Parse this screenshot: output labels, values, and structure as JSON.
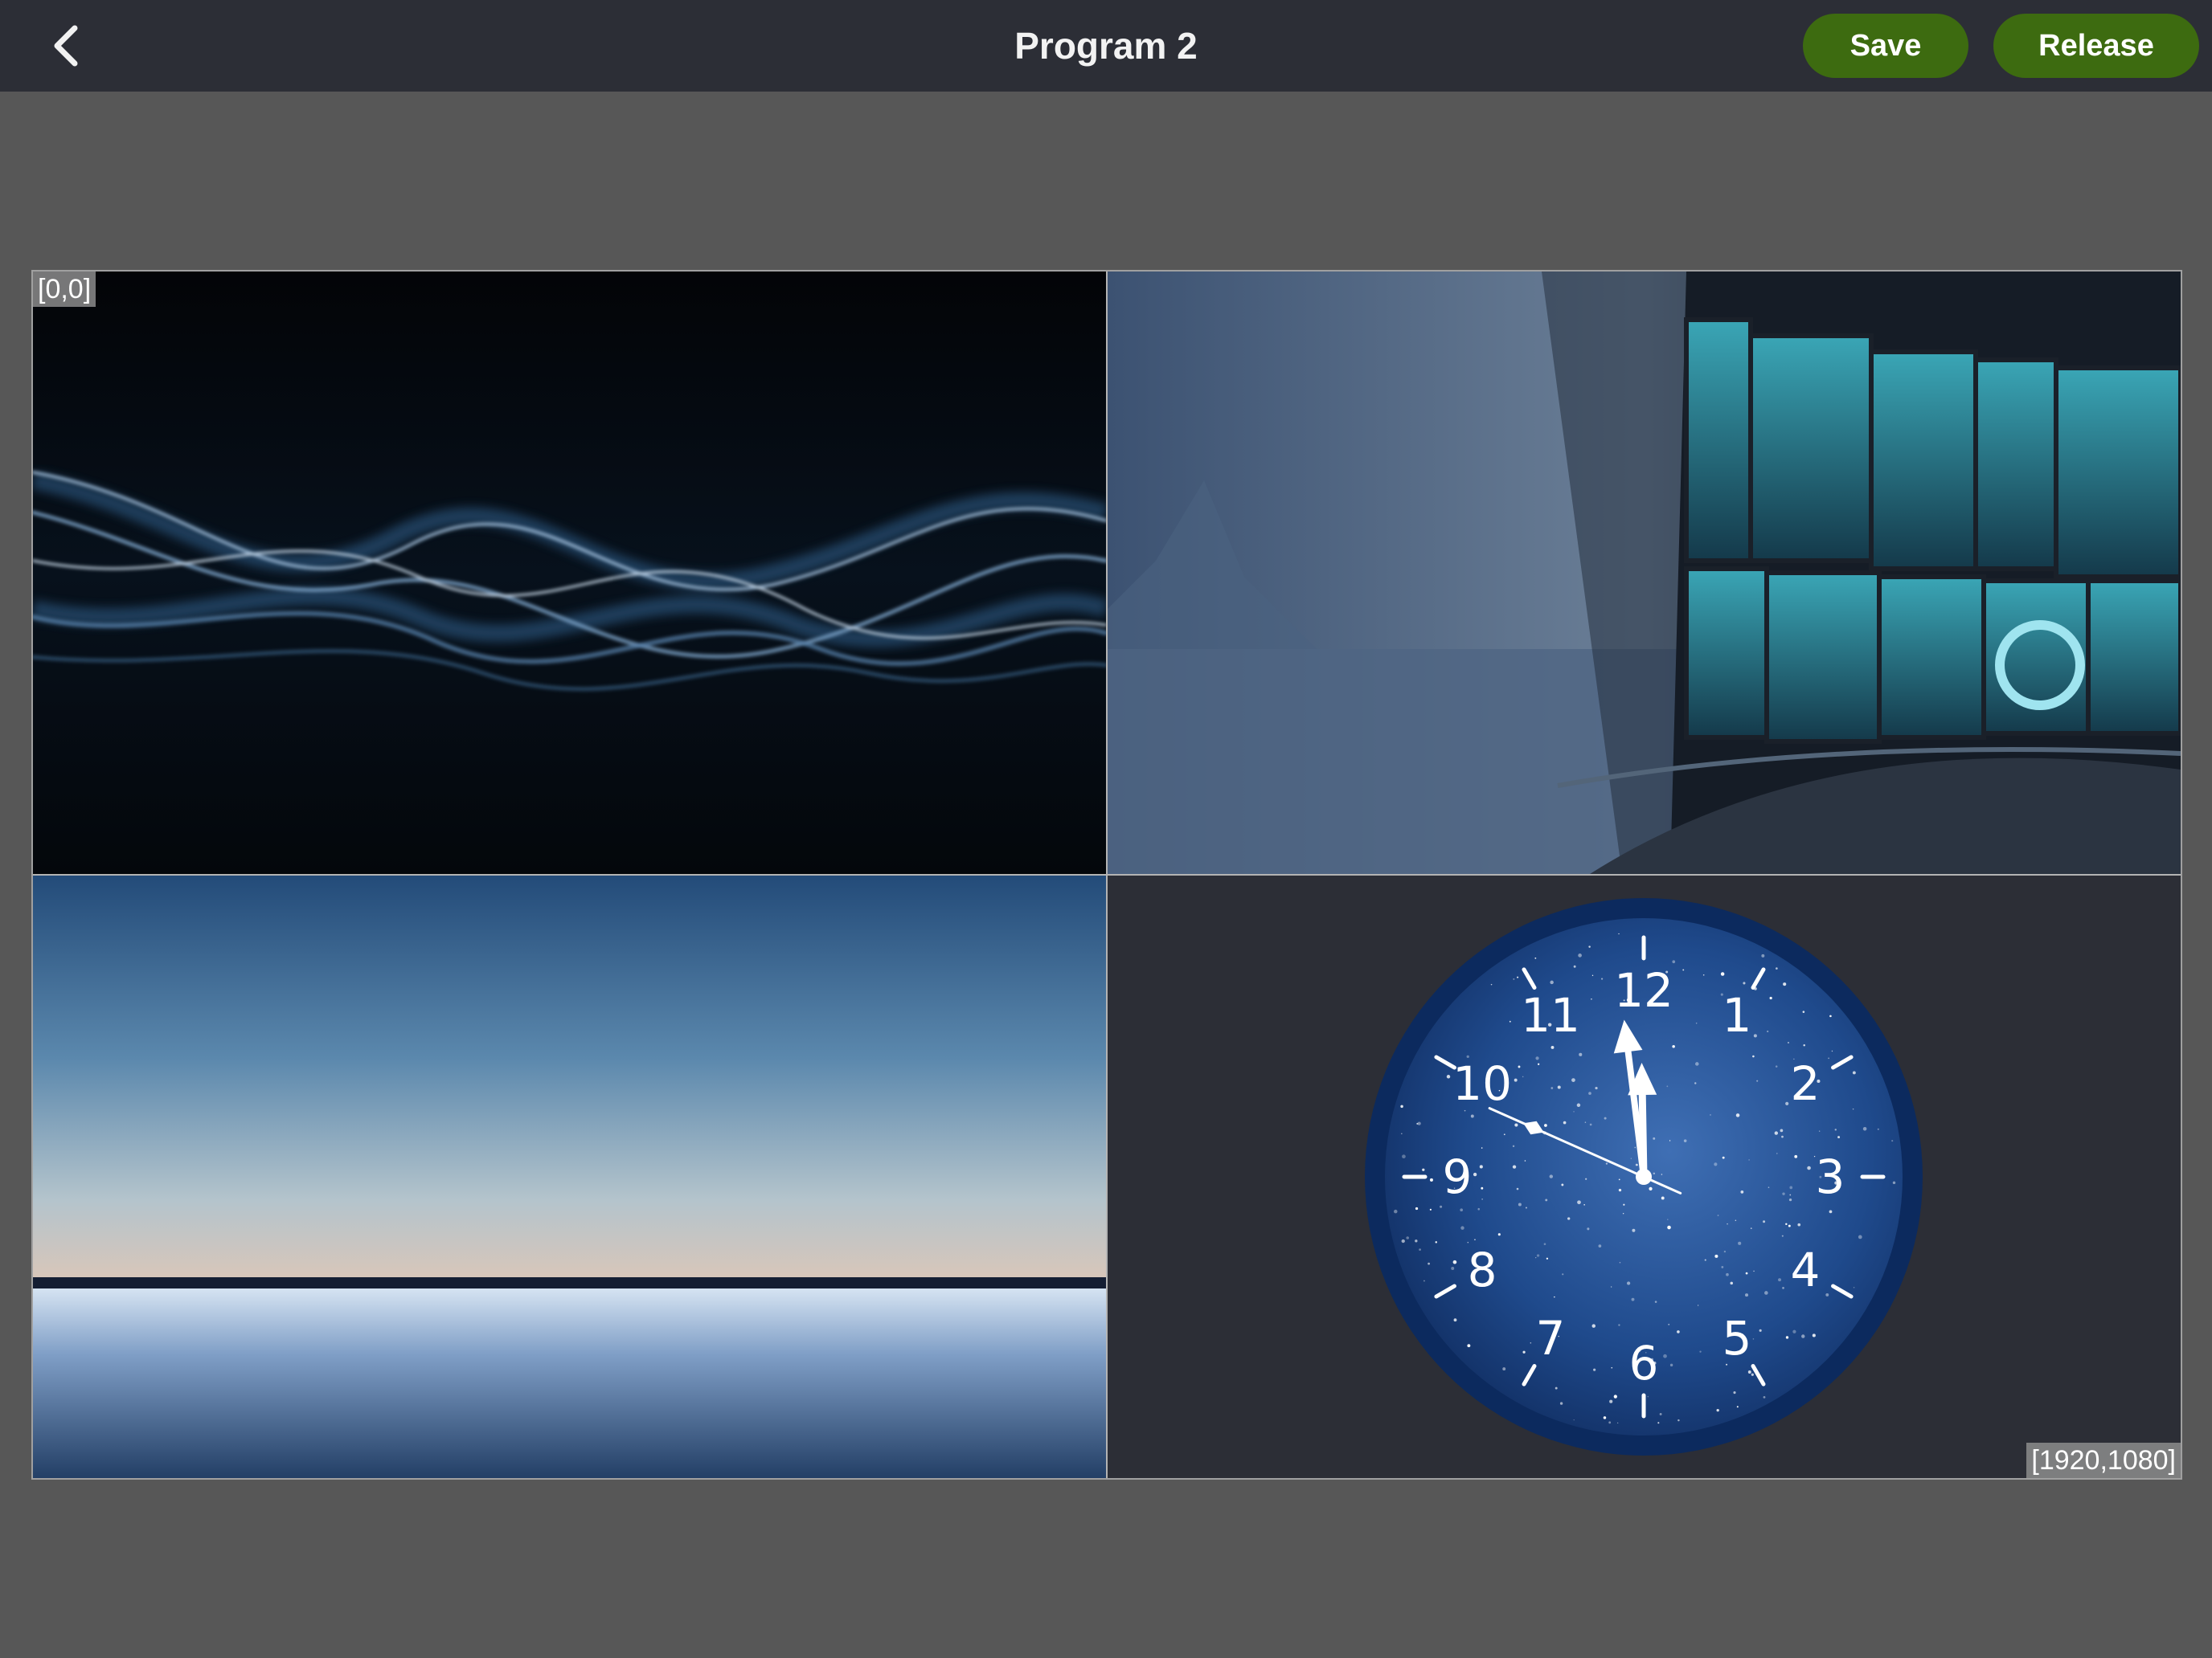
{
  "header": {
    "title": "Program 2",
    "back_icon": "chevron-left-icon",
    "save_label": "Save",
    "release_label": "Release"
  },
  "colors": {
    "topbar": "#2c2e36",
    "background": "#575757",
    "button": "#3d6b10"
  },
  "canvas": {
    "origin_label": "[0,0]",
    "extent_label": "[1920,1080]",
    "tiles": [
      {
        "name": "wave-light-image"
      },
      {
        "name": "control-room-image"
      },
      {
        "name": "horizon-sea-image"
      },
      {
        "name": "analog-clock-widget"
      }
    ]
  },
  "clock": {
    "numerals": [
      "12",
      "1",
      "2",
      "3",
      "4",
      "5",
      "6",
      "7",
      "8",
      "9",
      "10",
      "11"
    ],
    "time": "11:58:49"
  }
}
